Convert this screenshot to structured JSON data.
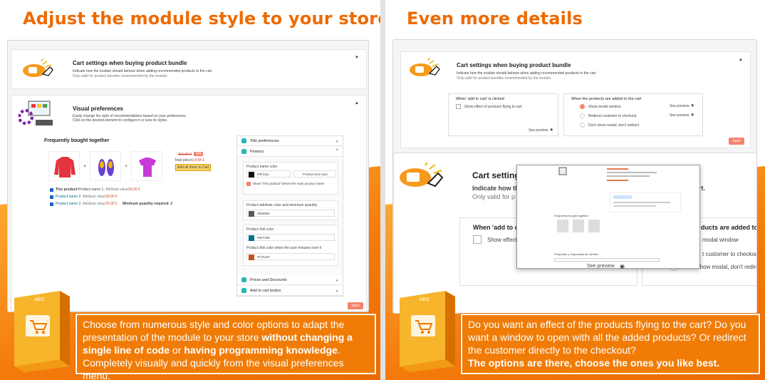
{
  "left": {
    "headline": "Adjust the module style to your store",
    "cart_section": {
      "title": "Cart settings when buying product bundle",
      "desc": "Indicate how the module should behave when adding recommended products to the cart.",
      "sub": "Only valid for product bundles recommended by the module."
    },
    "visual_section": {
      "title": "Visual preferences",
      "desc": "Easily change the style of recommendations based on your preferences.",
      "sub": "Click on the desired element to configure it or tune its styles."
    },
    "fbt": {
      "title": "Frequently bought together",
      "old_price": "116,00 €",
      "discount": "-5%",
      "total_label": "Total price:",
      "total_value": "114,84 €",
      "add_all_label": "Add all three to Cart",
      "rows": [
        {
          "name": "This product:",
          "rest": "Product name 1",
          "attr": "Attribute value",
          "price": "29,00 €",
          "extra": ""
        },
        {
          "name": "Product name 2",
          "rest": "",
          "attr": "Attribute value",
          "price": "29,00 €",
          "extra": ""
        },
        {
          "name": "Product name 3",
          "rest": "",
          "attr": "Attribute value",
          "price": "29,00 €",
          "extra": "Minimum quantity required: 2"
        }
      ]
    },
    "style_panel": {
      "title_prefs": "Title preferences",
      "product": "Product",
      "name_color_label": "Product name color",
      "name_color_value": "#0F1111",
      "text_color_btn": "Product text color",
      "show_this_product": "Show 'This product' before the main product name",
      "attr_color_label": "Product attribute color and minimum quantity",
      "attr_color_value": "#565959",
      "link_color_label": "Product link color",
      "link_color_value": "#007185",
      "link_hover_label": "Product link color when the user mouses over it",
      "link_hover_value": "#C7511F",
      "prices_discounts": "Prices and Discounts",
      "add_to_cart_btn": "Add to cart button",
      "save": "Save"
    },
    "promo": {
      "p1": "Choose from numerous style and color options to adapt the presentation of the module to your store ",
      "b1": "without changing a single line of code",
      "p2": " or ",
      "b2": "having programming knowledge",
      "p3": ". Completely visually and quickly from the visual preferences menu."
    }
  },
  "right": {
    "headline": "Even more details",
    "cart_section": {
      "title": "Cart settings when buying product bundle",
      "desc": "Indicate how the module should behave when adding recommended products to the cart.",
      "sub": "Only valid for product bundles recommended by the module."
    },
    "when_clicked": {
      "title": "When 'add to cart' is clicked",
      "option": "Show effect of products flying to cart",
      "see_preview": "See preview"
    },
    "when_added": {
      "title": "When the products are added to the cart",
      "options": [
        "Show modal window",
        "Redirect customer to checkout",
        "Don't show modal, don't redirect"
      ],
      "see_preview": "See preview"
    },
    "save": "Save",
    "zoom": {
      "title": "Cart setting",
      "desc_a": "Indicate how th",
      "desc_b": "cart.",
      "sub": "Only valid for p",
      "when_clicked": "When 'add to c",
      "show_effect": "Show effect",
      "when_added_tail": "ducts are added to t",
      "modal": "modal window",
      "redirect": "t customer to checkout",
      "dont_show": "Don't show modal, don't redire",
      "see_preview": "See preview"
    },
    "preview_popup": {
      "fbt_label": "Frequently bought together",
      "qa_label": "Preguntas y respuestas de clientes"
    },
    "promo": {
      "p1": "Do you want an effect of the products flying to the cart? Do you want a window to open with all the added products? Or redirect the customer directly to the checkout?",
      "b1": "The options are there, choose the ones you like best."
    }
  },
  "brand_label": "ABS"
}
